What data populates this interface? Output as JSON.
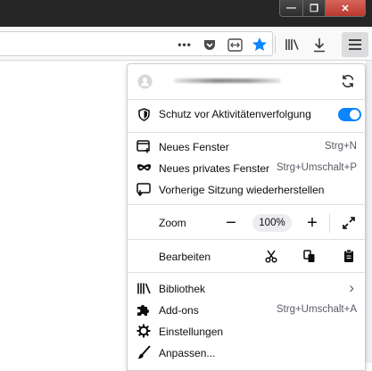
{
  "window_controls": {
    "minimize": "—",
    "maximize": "❐",
    "close": "✕"
  },
  "toolbar": {
    "icons": [
      "more-icon",
      "pocket-icon",
      "reader-icon",
      "bookmark-star-icon",
      "library-icon",
      "downloads-icon",
      "menu-icon"
    ],
    "more_glyph": "•••",
    "accent": "#0a84ff"
  },
  "menu": {
    "account": {
      "name_blurred": "",
      "sync_icon": "sync-icon"
    },
    "tracking": {
      "label": "Schutz vor Aktivitätenverfolgung",
      "enabled": true
    },
    "items": [
      {
        "label": "Neues Fenster",
        "shortcut": "Strg+N"
      },
      {
        "label": "Neues privates Fenster",
        "shortcut": "Strg+Umschalt+P"
      },
      {
        "label": "Vorherige Sitzung wiederherstellen",
        "shortcut": ""
      }
    ],
    "zoom": {
      "label": "Zoom",
      "minus": "−",
      "value": "100%",
      "plus": "+"
    },
    "edit": {
      "label": "Bearbeiten"
    },
    "bottom": [
      {
        "label": "Bibliothek",
        "shortcut": "›"
      },
      {
        "label": "Add-ons",
        "shortcut": "Strg+Umschalt+A"
      },
      {
        "label": "Einstellungen",
        "shortcut": ""
      },
      {
        "label": "Anpassen...",
        "shortcut": ""
      }
    ]
  }
}
